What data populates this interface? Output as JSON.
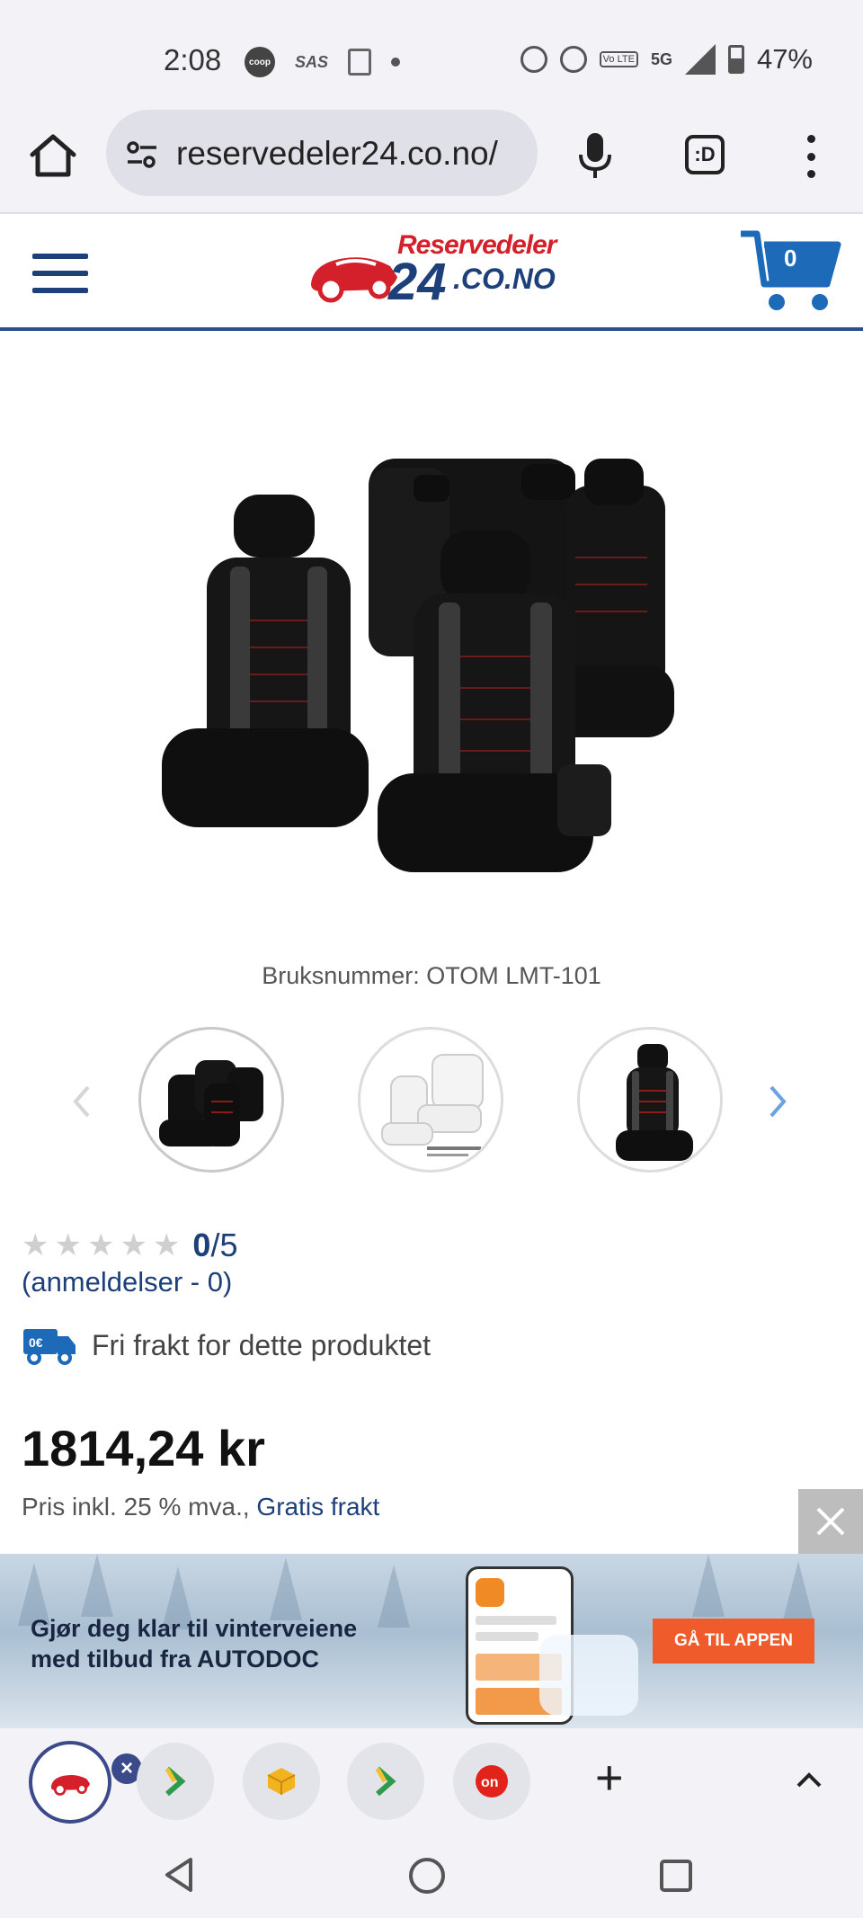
{
  "status_bar": {
    "time": "2:08",
    "sas": "SAS",
    "five_g": "5G",
    "volte": "Vo LTE",
    "battery": "47%"
  },
  "browser": {
    "url": "reservedeler24.co.no/",
    "tabs_label": ":D"
  },
  "site": {
    "logo_line1": "Reservedeler",
    "logo_number": "24",
    "logo_domain": ".CO.NO",
    "cart_count": "0"
  },
  "product": {
    "part_number": "Bruksnummer: OTOM LMT-101",
    "rating_value": "0",
    "rating_max": "/5",
    "stars_filled": 0,
    "reviews_link": "(anmeldelser - 0)",
    "shipping_badge": "0€",
    "shipping_text": "Fri frakt for dette produktet",
    "price": "1814,24 kr",
    "price_note": "Pris inkl. 25 % mva.,",
    "price_note_link": "Gratis frakt"
  },
  "thumbnails": [
    {
      "name": "black-seat-set"
    },
    {
      "name": "white-seat-diagram"
    },
    {
      "name": "single-black-seat"
    }
  ],
  "ad": {
    "title_line1": "Gjør deg klar til vinterveiene",
    "title_line2": "med tilbud fra AUTODOC",
    "button": "GÅ TIL APPEN"
  },
  "tab_strip": {
    "tabs": [
      "reservedeler24",
      "prisjakt",
      "package",
      "prisjakt",
      "on"
    ],
    "plus": "+"
  }
}
